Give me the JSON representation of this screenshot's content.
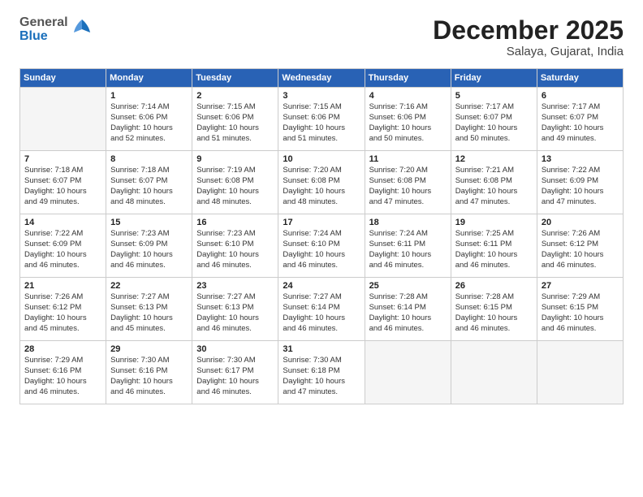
{
  "logo": {
    "general": "General",
    "blue": "Blue"
  },
  "header": {
    "month": "December 2025",
    "location": "Salaya, Gujarat, India"
  },
  "weekdays": [
    "Sunday",
    "Monday",
    "Tuesday",
    "Wednesday",
    "Thursday",
    "Friday",
    "Saturday"
  ],
  "weeks": [
    [
      {
        "day": "",
        "empty": true
      },
      {
        "day": "1",
        "sunrise": "7:14 AM",
        "sunset": "6:06 PM",
        "daylight": "10 hours and 52 minutes."
      },
      {
        "day": "2",
        "sunrise": "7:15 AM",
        "sunset": "6:06 PM",
        "daylight": "10 hours and 51 minutes."
      },
      {
        "day": "3",
        "sunrise": "7:15 AM",
        "sunset": "6:06 PM",
        "daylight": "10 hours and 51 minutes."
      },
      {
        "day": "4",
        "sunrise": "7:16 AM",
        "sunset": "6:06 PM",
        "daylight": "10 hours and 50 minutes."
      },
      {
        "day": "5",
        "sunrise": "7:17 AM",
        "sunset": "6:07 PM",
        "daylight": "10 hours and 50 minutes."
      },
      {
        "day": "6",
        "sunrise": "7:17 AM",
        "sunset": "6:07 PM",
        "daylight": "10 hours and 49 minutes."
      }
    ],
    [
      {
        "day": "7",
        "sunrise": "7:18 AM",
        "sunset": "6:07 PM",
        "daylight": "10 hours and 49 minutes."
      },
      {
        "day": "8",
        "sunrise": "7:18 AM",
        "sunset": "6:07 PM",
        "daylight": "10 hours and 48 minutes."
      },
      {
        "day": "9",
        "sunrise": "7:19 AM",
        "sunset": "6:08 PM",
        "daylight": "10 hours and 48 minutes."
      },
      {
        "day": "10",
        "sunrise": "7:20 AM",
        "sunset": "6:08 PM",
        "daylight": "10 hours and 48 minutes."
      },
      {
        "day": "11",
        "sunrise": "7:20 AM",
        "sunset": "6:08 PM",
        "daylight": "10 hours and 47 minutes."
      },
      {
        "day": "12",
        "sunrise": "7:21 AM",
        "sunset": "6:08 PM",
        "daylight": "10 hours and 47 minutes."
      },
      {
        "day": "13",
        "sunrise": "7:22 AM",
        "sunset": "6:09 PM",
        "daylight": "10 hours and 47 minutes."
      }
    ],
    [
      {
        "day": "14",
        "sunrise": "7:22 AM",
        "sunset": "6:09 PM",
        "daylight": "10 hours and 46 minutes."
      },
      {
        "day": "15",
        "sunrise": "7:23 AM",
        "sunset": "6:09 PM",
        "daylight": "10 hours and 46 minutes."
      },
      {
        "day": "16",
        "sunrise": "7:23 AM",
        "sunset": "6:10 PM",
        "daylight": "10 hours and 46 minutes."
      },
      {
        "day": "17",
        "sunrise": "7:24 AM",
        "sunset": "6:10 PM",
        "daylight": "10 hours and 46 minutes."
      },
      {
        "day": "18",
        "sunrise": "7:24 AM",
        "sunset": "6:11 PM",
        "daylight": "10 hours and 46 minutes."
      },
      {
        "day": "19",
        "sunrise": "7:25 AM",
        "sunset": "6:11 PM",
        "daylight": "10 hours and 46 minutes."
      },
      {
        "day": "20",
        "sunrise": "7:26 AM",
        "sunset": "6:12 PM",
        "daylight": "10 hours and 46 minutes."
      }
    ],
    [
      {
        "day": "21",
        "sunrise": "7:26 AM",
        "sunset": "6:12 PM",
        "daylight": "10 hours and 45 minutes."
      },
      {
        "day": "22",
        "sunrise": "7:27 AM",
        "sunset": "6:13 PM",
        "daylight": "10 hours and 45 minutes."
      },
      {
        "day": "23",
        "sunrise": "7:27 AM",
        "sunset": "6:13 PM",
        "daylight": "10 hours and 46 minutes."
      },
      {
        "day": "24",
        "sunrise": "7:27 AM",
        "sunset": "6:14 PM",
        "daylight": "10 hours and 46 minutes."
      },
      {
        "day": "25",
        "sunrise": "7:28 AM",
        "sunset": "6:14 PM",
        "daylight": "10 hours and 46 minutes."
      },
      {
        "day": "26",
        "sunrise": "7:28 AM",
        "sunset": "6:15 PM",
        "daylight": "10 hours and 46 minutes."
      },
      {
        "day": "27",
        "sunrise": "7:29 AM",
        "sunset": "6:15 PM",
        "daylight": "10 hours and 46 minutes."
      }
    ],
    [
      {
        "day": "28",
        "sunrise": "7:29 AM",
        "sunset": "6:16 PM",
        "daylight": "10 hours and 46 minutes."
      },
      {
        "day": "29",
        "sunrise": "7:30 AM",
        "sunset": "6:16 PM",
        "daylight": "10 hours and 46 minutes."
      },
      {
        "day": "30",
        "sunrise": "7:30 AM",
        "sunset": "6:17 PM",
        "daylight": "10 hours and 46 minutes."
      },
      {
        "day": "31",
        "sunrise": "7:30 AM",
        "sunset": "6:18 PM",
        "daylight": "10 hours and 47 minutes."
      },
      {
        "day": "",
        "empty": true
      },
      {
        "day": "",
        "empty": true
      },
      {
        "day": "",
        "empty": true
      }
    ]
  ],
  "labels": {
    "sunrise": "Sunrise:",
    "sunset": "Sunset:",
    "daylight": "Daylight:"
  }
}
